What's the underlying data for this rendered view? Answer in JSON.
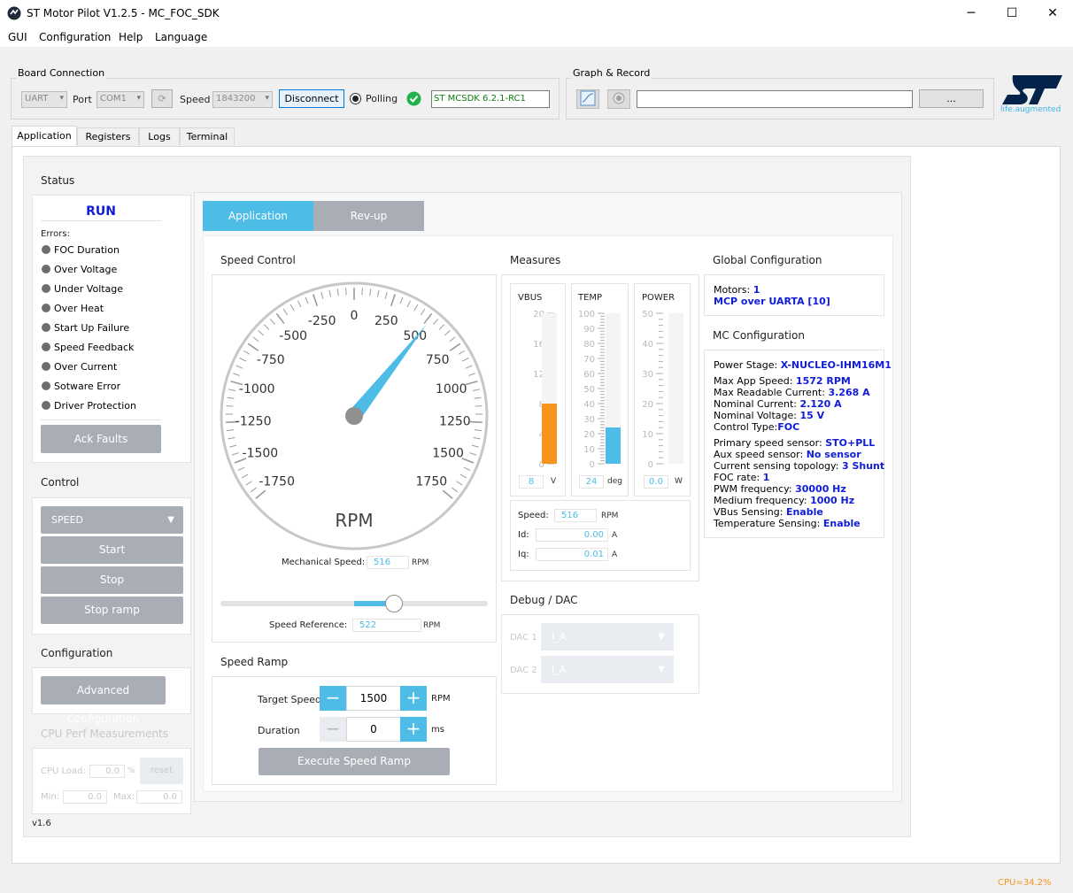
{
  "window": {
    "title": "ST Motor Pilot V1.2.5 - MC_FOC_SDK",
    "minimize": "─",
    "maximize": "☐",
    "close": "✕"
  },
  "menu": [
    "GUI",
    "Configuration",
    "Help",
    "Language"
  ],
  "board_connection": {
    "title": "Board Connection",
    "interface": "UART",
    "port_label": "Port",
    "port": "COM1",
    "speed_label": "Speed",
    "speed": "1843200",
    "disconnect": "Disconnect",
    "polling_label": "Polling",
    "firmware": "ST MCSDK 6.2.1-RC1"
  },
  "graph_record": {
    "title": "Graph & Record",
    "path": "",
    "browse": "..."
  },
  "logo": {
    "tagline": "life.augmented",
    "brand_color": "#03234b",
    "accent_color": "#3cb4e6"
  },
  "main_tabs": [
    "Application",
    "Registers",
    "Logs",
    "Terminal"
  ],
  "status": {
    "title": "Status",
    "state": "RUN",
    "errors_label": "Errors:",
    "errors": [
      "FOC Duration",
      "Over Voltage",
      "Under Voltage",
      "Over Heat",
      "Start Up Failure",
      "Speed Feedback",
      "Over Current",
      "Sotware Error",
      "Driver Protection"
    ],
    "ack": "Ack Faults"
  },
  "control": {
    "title": "Control",
    "mode": "SPEED",
    "start": "Start",
    "stop": "Stop",
    "stop_ramp": "Stop ramp"
  },
  "configuration": {
    "title": "Configuration",
    "advanced": "Advanced Configuration"
  },
  "cpu_perf": {
    "title": "CPU Perf Measurements",
    "load_label": "CPU Load:",
    "load": "0.0",
    "load_unit": "%",
    "reset": "reset",
    "min_label": "Min:",
    "min": "0.0",
    "max_label": "Max:",
    "max": "0.0"
  },
  "version": "v1.6",
  "sub_tabs": {
    "application": "Application",
    "revup": "Rev-up"
  },
  "speed_control": {
    "title": "Speed Control",
    "gauge_unit": "RPM",
    "gauge_labels": [
      "-1750",
      "-1500",
      "-1250",
      "-1000",
      "-750",
      "-500",
      "-250",
      "0",
      "250",
      "500",
      "750",
      "1000",
      "1250",
      "1500",
      "1750"
    ],
    "gauge_min": -1750,
    "gauge_max": 1750,
    "gauge_value": 516,
    "mech_speed_label": "Mechanical Speed:",
    "mech_speed": "516",
    "mech_speed_unit": "RPM",
    "slider_min": -1750,
    "slider_max": 1750,
    "slider_value": 522,
    "speed_ref_label": "Speed Reference:",
    "speed_ref": "522",
    "speed_ref_unit": "RPM"
  },
  "speed_ramp": {
    "title": "Speed Ramp",
    "target_label": "Target Speed",
    "target": "1500",
    "target_unit": "RPM",
    "duration_label": "Duration",
    "duration": "0",
    "duration_unit": "ms",
    "execute": "Execute Speed Ramp"
  },
  "measures": {
    "title": "Measures",
    "vbus": {
      "label": "VBUS",
      "ticks": [
        "20",
        "16",
        "12",
        "8",
        "4",
        "0"
      ],
      "max": 20,
      "value": 8,
      "display": "8",
      "unit": "V",
      "color": "#f7941d"
    },
    "temp": {
      "label": "TEMP",
      "ticks": [
        "100",
        "90",
        "80",
        "70",
        "60",
        "50",
        "40",
        "30",
        "20",
        "10",
        "0"
      ],
      "max": 100,
      "value": 24,
      "display": "24",
      "unit": "deg",
      "color": "#4dbde7"
    },
    "power": {
      "label": "POWER",
      "ticks": [
        "50",
        "40",
        "30",
        "20",
        "10",
        "0"
      ],
      "max": 50,
      "value": 0,
      "display": "0.0",
      "unit": "W",
      "color": "#4dbde7"
    },
    "speed_label": "Speed:",
    "speed": "516",
    "speed_unit": "RPM",
    "id_label": "Id:",
    "id": "0.00",
    "id_unit": "A",
    "iq_label": "Iq:",
    "iq": "0.01",
    "iq_unit": "A"
  },
  "debug": {
    "title": "Debug / DAC",
    "dac1_label": "DAC 1",
    "dac1": "I_A",
    "dac2_label": "DAC 2",
    "dac2": "I_A"
  },
  "global_config": {
    "title": "Global Configuration",
    "motors_label": "Motors:",
    "motors": "1",
    "link": "MCP over UARTA [10]"
  },
  "mc_config": {
    "title": "MC Configuration",
    "power_stage_label": "Power Stage:",
    "power_stage": "X-NUCLEO-IHM16M1",
    "rows1": [
      {
        "k": "Max App Speed:",
        "v": "1572 RPM"
      },
      {
        "k": "Max Readable Current:",
        "v": "3.268 A"
      },
      {
        "k": "Nominal Current:",
        "v": "2.120 A"
      },
      {
        "k": "Nominal Voltage:",
        "v": "15 V"
      },
      {
        "k": "Control Type:",
        "v": "FOC"
      }
    ],
    "rows2": [
      {
        "k": "Primary speed sensor:",
        "v": "STO+PLL"
      },
      {
        "k": "Aux speed sensor:",
        "v": "No sensor"
      },
      {
        "k": "Current sensing topology:",
        "v": "3 Shunt"
      },
      {
        "k": "FOC rate:",
        "v": "1"
      },
      {
        "k": "PWM frequency:",
        "v": "30000 Hz"
      },
      {
        "k": "Medium frequency:",
        "v": "1000 Hz"
      },
      {
        "k": "VBus Sensing:",
        "v": "Enable"
      },
      {
        "k": "Temperature Sensing:",
        "v": "Enable"
      }
    ]
  },
  "status_bar": {
    "cpu": "CPU=34.2%"
  }
}
